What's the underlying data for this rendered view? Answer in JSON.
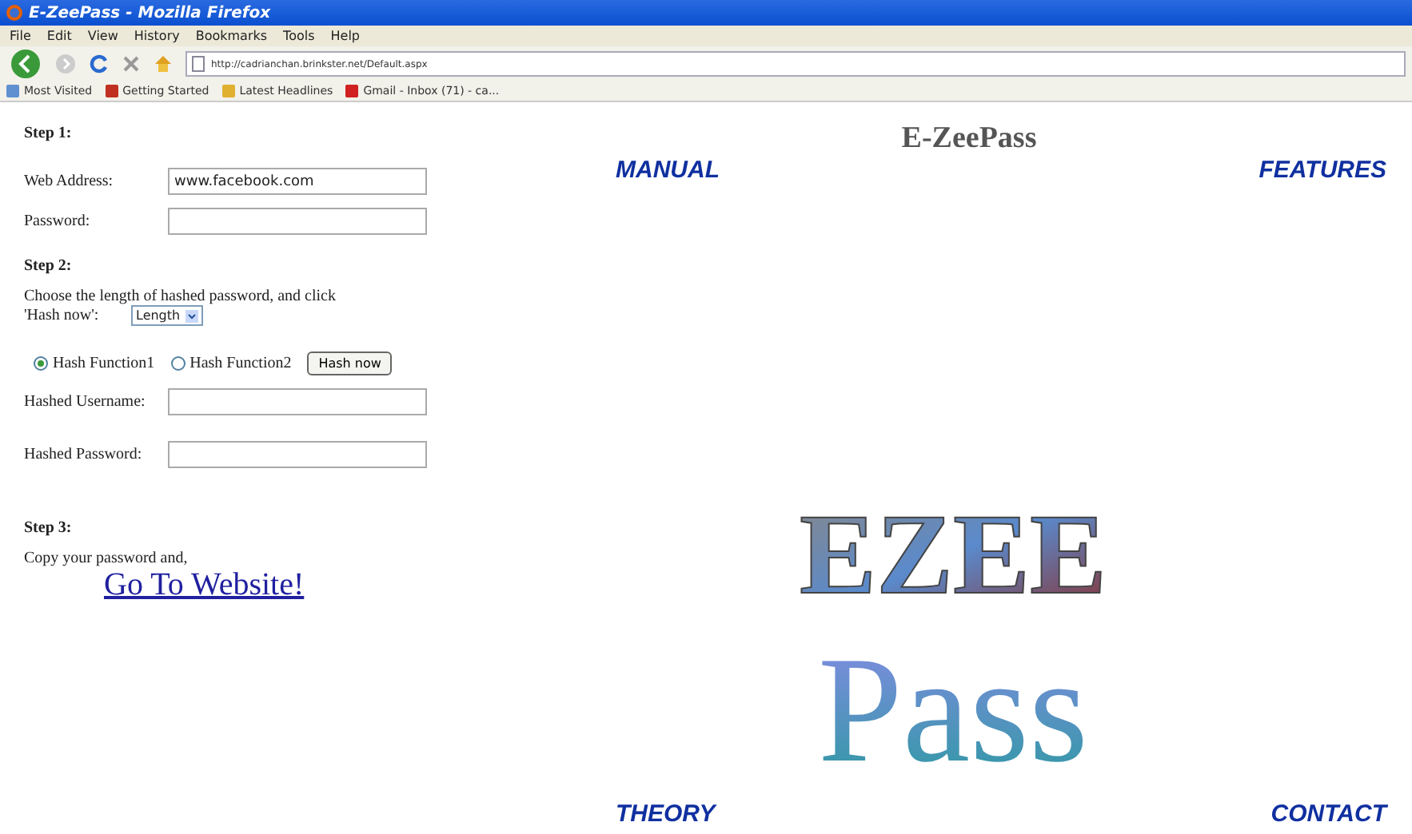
{
  "window": {
    "title": "E-ZeePass - Mozilla Firefox"
  },
  "menu": [
    "File",
    "Edit",
    "View",
    "History",
    "Bookmarks",
    "Tools",
    "Help"
  ],
  "address": "http://cadrianchan.brinkster.net/Default.aspx",
  "bookmarks": [
    {
      "label": "Most Visited",
      "kind": "page"
    },
    {
      "label": "Getting Started",
      "kind": "start"
    },
    {
      "label": "Latest Headlines",
      "kind": "folder"
    },
    {
      "label": "Gmail - Inbox (71) - ca...",
      "kind": "mail"
    }
  ],
  "form": {
    "step1": "Step 1:",
    "web_label": "Web Address:",
    "web_value": "www.facebook.com",
    "password_label": "Password:",
    "step2": "Step 2:",
    "instruction": "Choose the length of hashed password, and click",
    "instruction_2": "'Hash now':",
    "length_select": "Length",
    "radios": [
      {
        "label": "Hash Function1",
        "selected": true
      },
      {
        "label": "Hash Function2",
        "selected": false
      }
    ],
    "hash_button": "Hash now",
    "hashed_user_label": "Hashed Username:",
    "hashed_pass_label": "Hashed Password:",
    "step3": "Step 3:",
    "copy_text": "Copy your password and,",
    "go_link": "Go To Website!"
  },
  "site": {
    "title": "E-ZeePass",
    "links_top": [
      "MANUAL",
      "FEATURES"
    ],
    "links_bottom": [
      "THEORY",
      "CONTACT"
    ],
    "logo": {
      "line_1": "EZEE",
      "line_2": "Pass"
    }
  }
}
